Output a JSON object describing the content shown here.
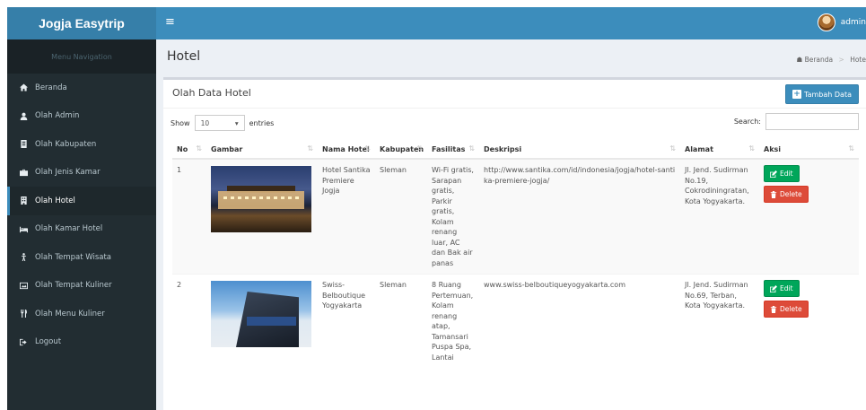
{
  "app": {
    "brand": "Jogja Easytrip",
    "user_name": "admin"
  },
  "sidebar": {
    "header": "Menu Navigation",
    "items": [
      {
        "label": "Beranda",
        "icon": "home-icon"
      },
      {
        "label": "Olah Admin",
        "icon": "user-icon"
      },
      {
        "label": "Olah Kabupaten",
        "icon": "document-icon"
      },
      {
        "label": "Olah Jenis Kamar",
        "icon": "briefcase-icon"
      },
      {
        "label": "Olah Hotel",
        "icon": "building-icon"
      },
      {
        "label": "Olah Kamar Hotel",
        "icon": "bed-icon"
      },
      {
        "label": "Olah Tempat Wisata",
        "icon": "child-icon"
      },
      {
        "label": "Olah Tempat Kuliner",
        "icon": "image-icon"
      },
      {
        "label": "Olah Menu Kuliner",
        "icon": "cutlery-icon"
      },
      {
        "label": "Logout",
        "icon": "signout-icon"
      }
    ],
    "active_index": 4
  },
  "page": {
    "title": "Hotel",
    "breadcrumb": [
      "Beranda",
      "Hote"
    ]
  },
  "box": {
    "title": "Olah Data Hotel",
    "add_label": "Tambah Data",
    "show_label": "Show",
    "entries_value": "10",
    "entries_label": "entries",
    "search_label": "Search:"
  },
  "table": {
    "columns": [
      "No",
      "Gambar",
      "Nama Hotel",
      "Kabupaten",
      "Fasilitas",
      "Deskripsi",
      "Alamat",
      "Aksi"
    ],
    "rows": [
      {
        "no": "1",
        "nama": "Hotel Santika Premiere Jogja",
        "kabupaten": "Sleman",
        "fasilitas": "Wi-Fi gratis, Sarapan gratis, Parkir gratis, Kolam renang luar, AC dan Bak air panas",
        "deskripsi": "http://www.santika.com/id/indonesia/jogja/hotel-santika-premiere-jogja/",
        "alamat": "Jl. Jend. Sudirman No.19, Cokrodiningratan, Kota Yogyakarta."
      },
      {
        "no": "2",
        "nama": "Swiss-Belboutique Yogyakarta",
        "kabupaten": "Sleman",
        "fasilitas": "8 Ruang Pertemuan, Kolam renang atap, Tamansari Puspa Spa, Lantai",
        "deskripsi": "www.swiss-belboutiqueyogyakarta.com",
        "alamat": "Jl. Jend. Sudirman No.69, Terban, Kota Yogyakarta."
      }
    ],
    "edit_label": "Edit",
    "delete_label": "Delete"
  },
  "colors": {
    "brand": "#367fa9",
    "topbar": "#3c8dbc",
    "sidebar": "#222d32",
    "edit": "#00a65a",
    "delete": "#dd4b39"
  }
}
